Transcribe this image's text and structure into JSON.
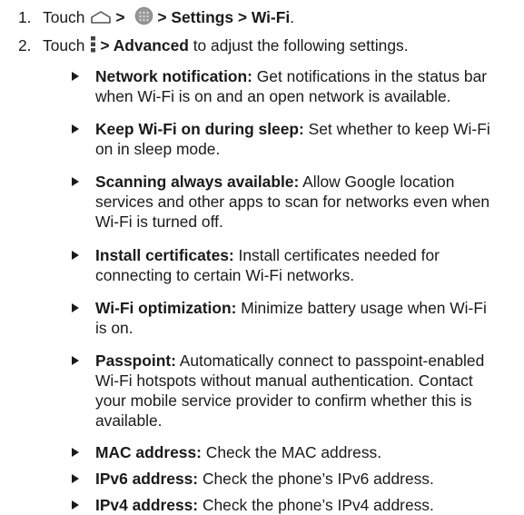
{
  "steps": [
    {
      "number": "1.",
      "prefix": "Touch",
      "parts": [
        "> ",
        "> Settings > Wi-Fi",
        "."
      ],
      "icons": [
        "home-icon",
        "apps-icon"
      ]
    },
    {
      "number": "2.",
      "prefix": "Touch",
      "bold": "> Advanced",
      "suffix": " to adjust the following settings.",
      "icons": [
        "menu-icon"
      ]
    }
  ],
  "bullets": [
    {
      "label": "Network notification:",
      "lines": [
        " Get notifications in the status bar",
        "when Wi-Fi is on and an open network is available."
      ]
    },
    {
      "label": "Keep Wi-Fi on during sleep:",
      "lines": [
        " Set whether to keep Wi-Fi",
        "on in sleep mode."
      ]
    },
    {
      "label": "Scanning always available:",
      "lines": [
        " Allow Google location",
        "services and other apps to scan for networks even when",
        "Wi-Fi is turned off."
      ]
    },
    {
      "label": "Install certificates:",
      "lines": [
        " Install certificates needed for",
        "connecting to certain Wi-Fi networks."
      ]
    },
    {
      "label": "Wi-Fi optimization:",
      "lines": [
        " Minimize battery usage when Wi-Fi",
        "is on."
      ]
    },
    {
      "label": "Passpoint:",
      "lines": [
        " Automatically connect to passpoint-enabled",
        "Wi-Fi hotspots without manual authentication. Contact",
        "your mobile service provider to confirm whether this is",
        "available."
      ]
    },
    {
      "label": "MAC address:",
      "lines": [
        " Check the MAC address."
      ]
    },
    {
      "label": "IPv6 address:",
      "lines": [
        " Check the phone’s IPv6 address."
      ]
    },
    {
      "label": "IPv4 address:",
      "lines": [
        " Check the phone’s IPv4 address."
      ]
    }
  ]
}
